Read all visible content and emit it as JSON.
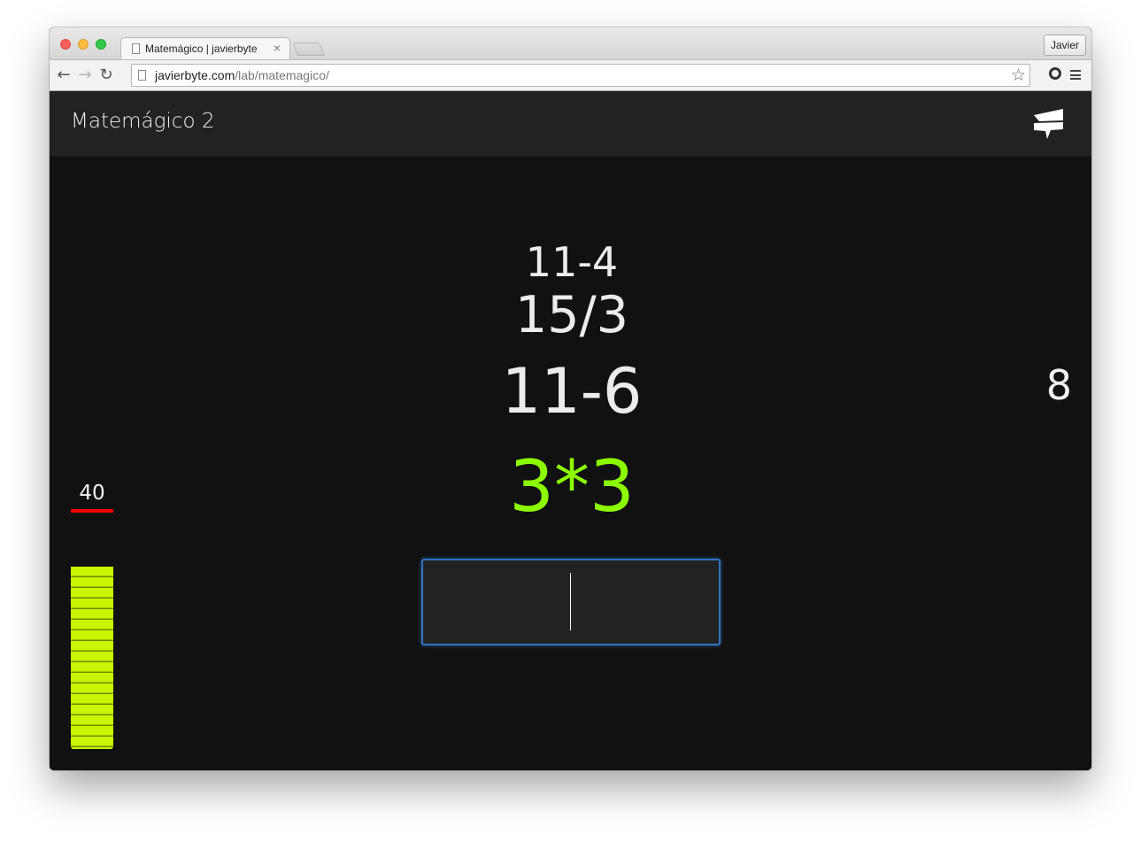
{
  "browser": {
    "tab_title": "Matemágico | javierbyte",
    "tab_close": "×",
    "profile": "Javier",
    "url_host": "javierbyte.com",
    "url_path": "/lab/matemagico/",
    "colors": {
      "close": "#fc605b",
      "minimize": "#fdbc40",
      "maximize": "#34c84a"
    }
  },
  "app": {
    "title": "Matemágico 2",
    "logo_icon": "flag-logo-icon"
  },
  "game": {
    "previous_equations": [
      "11-4",
      "15/3",
      "11-6"
    ],
    "current_equation": "3*3",
    "side_number": "8",
    "score": "40",
    "time_remaining_fraction": 1.0,
    "answer_value": "",
    "colors": {
      "current": "#8dfb00",
      "score_line": "#ff0000",
      "meter": "#c9f500",
      "input_border": "#2f74c0"
    }
  }
}
